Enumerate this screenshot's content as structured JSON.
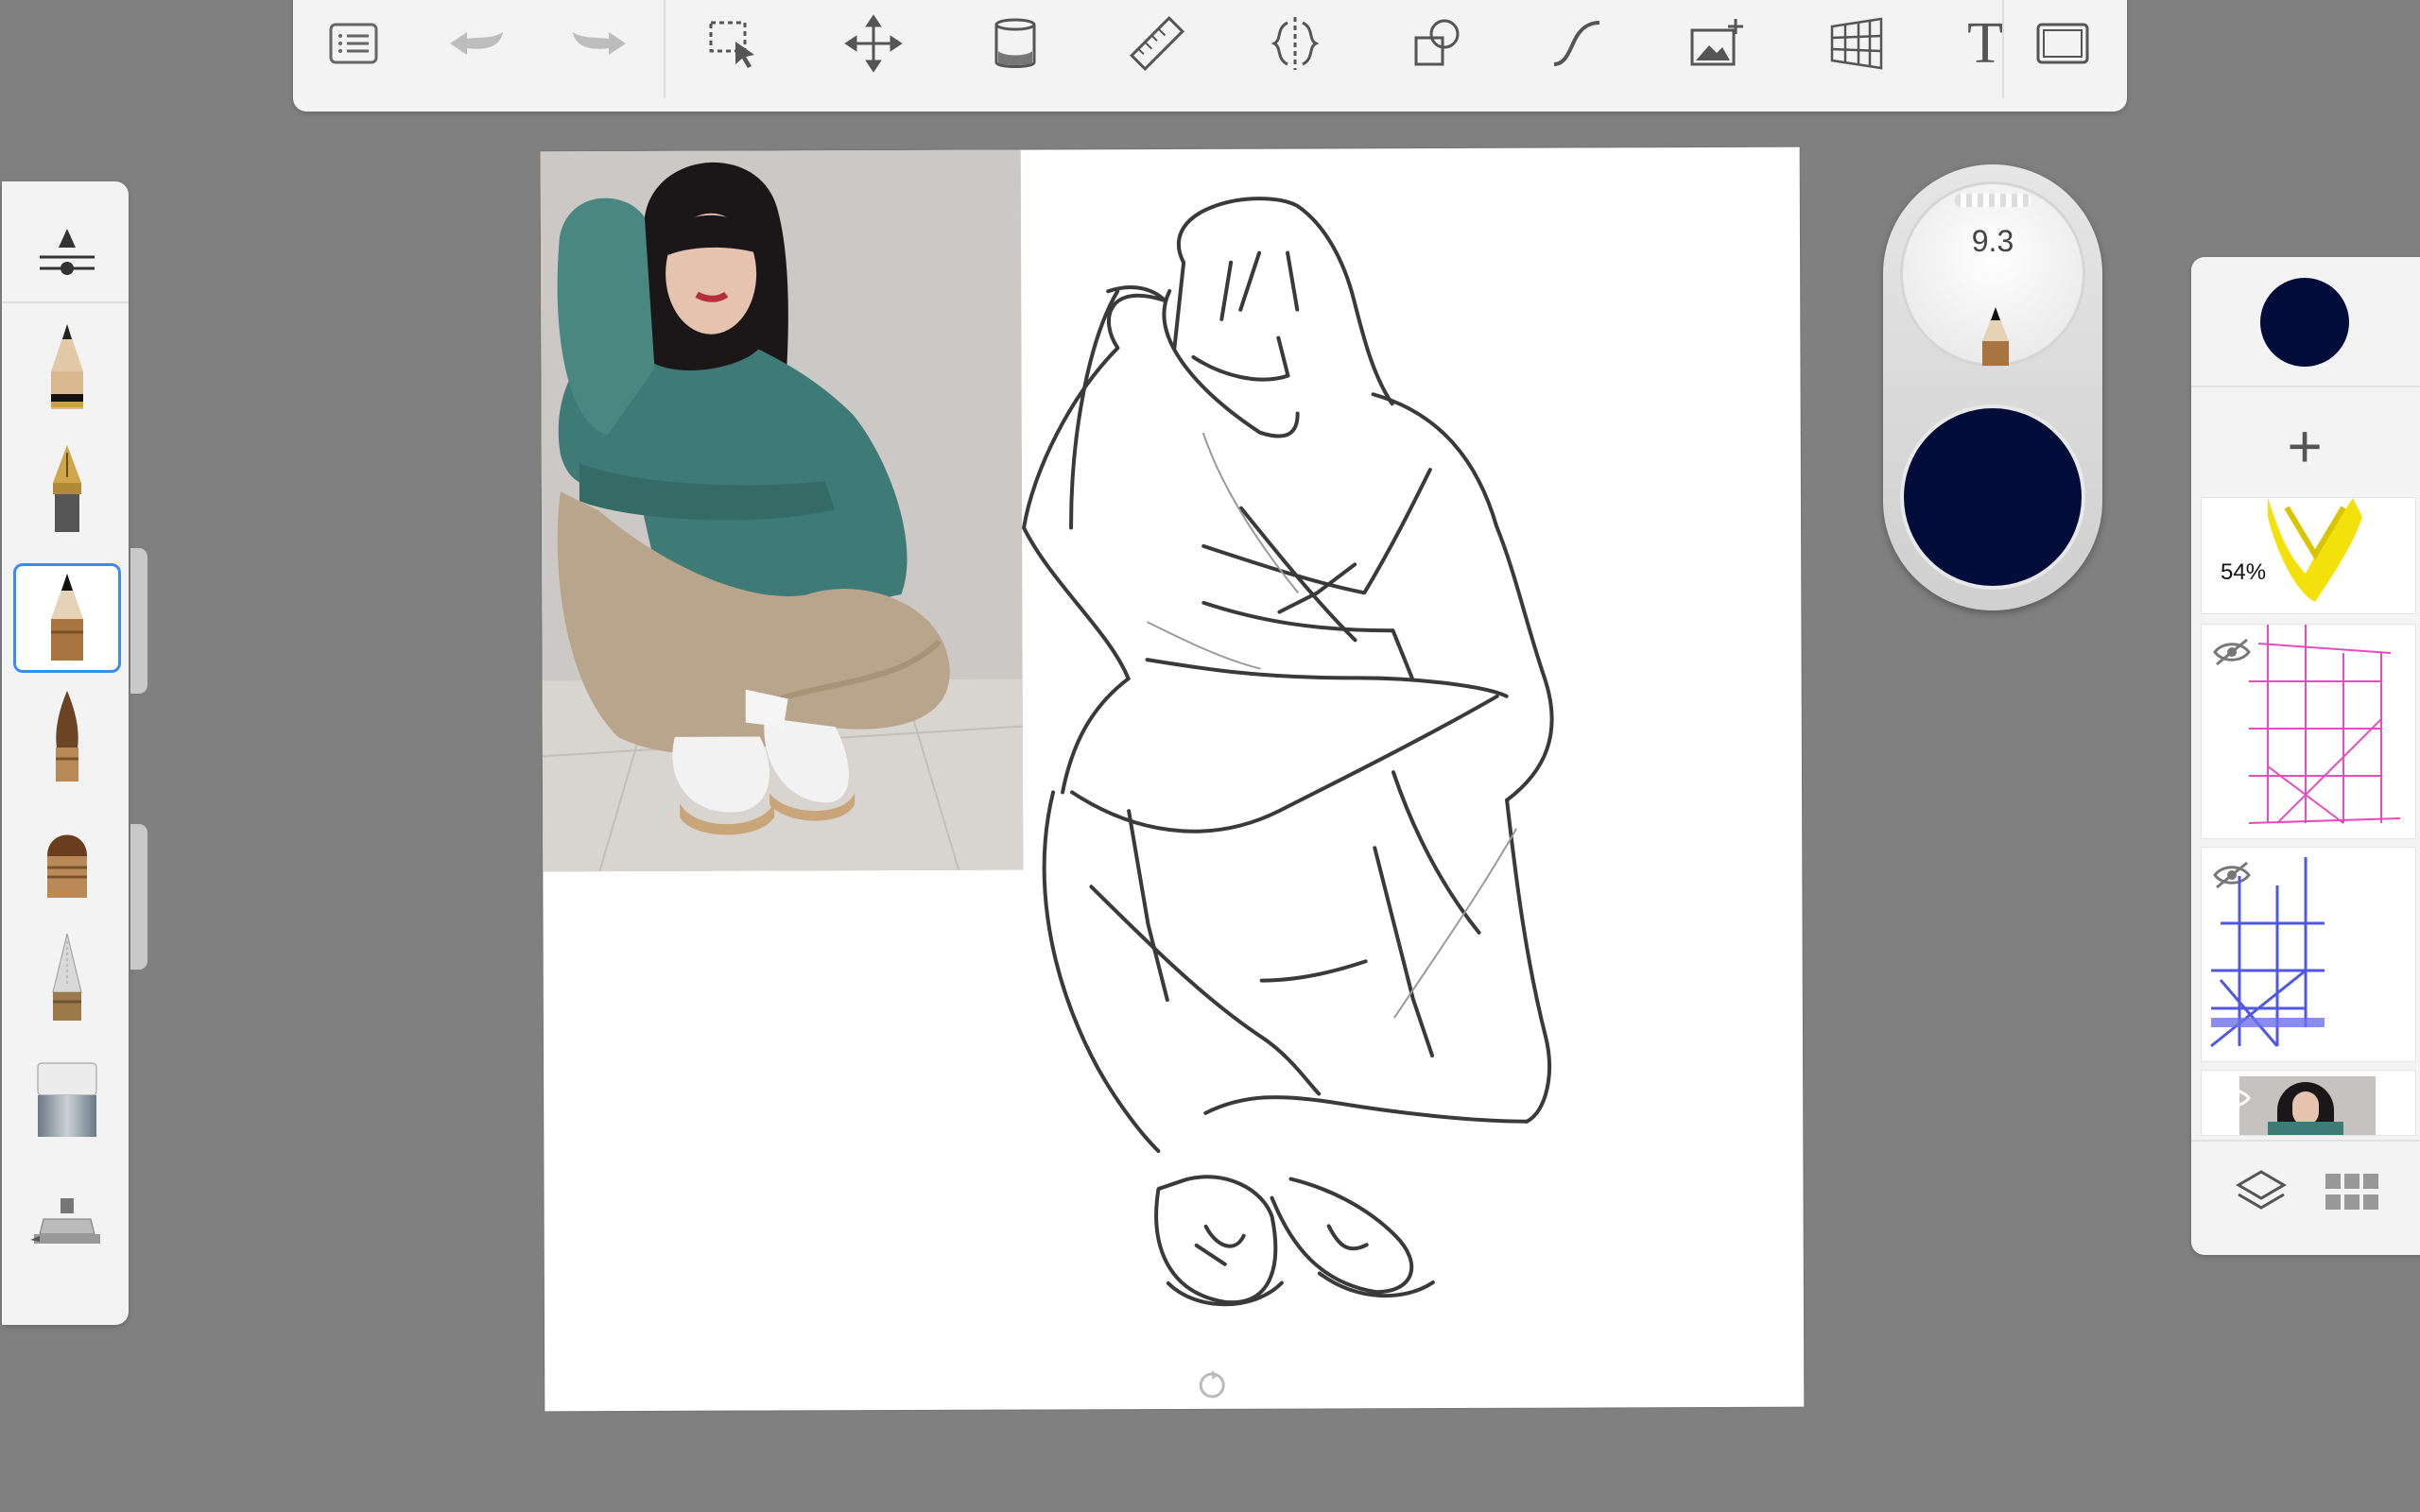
{
  "toolbar": {
    "items": [
      {
        "name": "menu-list",
        "icon": "list-icon"
      },
      {
        "name": "undo",
        "icon": "undo-icon"
      },
      {
        "name": "redo",
        "icon": "redo-icon"
      },
      {
        "name": "selection",
        "icon": "selection-icon"
      },
      {
        "name": "transform",
        "icon": "move-icon"
      },
      {
        "name": "fill",
        "icon": "paint-bucket-icon"
      },
      {
        "name": "ruler",
        "icon": "ruler-icon"
      },
      {
        "name": "symmetry",
        "icon": "symmetry-icon"
      },
      {
        "name": "shapes",
        "icon": "shapes-icon"
      },
      {
        "name": "stroke",
        "icon": "curve-icon"
      },
      {
        "name": "add-image",
        "icon": "add-image-icon"
      },
      {
        "name": "perspective",
        "icon": "perspective-grid-icon"
      },
      {
        "name": "text",
        "icon": "text-icon",
        "label": "T"
      },
      {
        "name": "fullscreen",
        "icon": "fullscreen-icon"
      }
    ]
  },
  "brush_palette": {
    "items": [
      {
        "name": "brush-properties",
        "icon": "brush-settings-icon"
      },
      {
        "name": "pencil",
        "icon": "pencil-icon"
      },
      {
        "name": "ink-pen",
        "icon": "fountain-pen-icon"
      },
      {
        "name": "hard-pencil",
        "icon": "pencil-icon",
        "selected": true
      },
      {
        "name": "paint-brush",
        "icon": "paintbrush-icon"
      },
      {
        "name": "flat-brush",
        "icon": "flat-brush-icon"
      },
      {
        "name": "airbrush",
        "icon": "airbrush-icon"
      },
      {
        "name": "eraser",
        "icon": "eraser-icon"
      },
      {
        "name": "smudge",
        "icon": "smudge-icon"
      }
    ]
  },
  "puck": {
    "brush_size": "9.3",
    "brush_icon": "pencil-icon",
    "color": "#020d3a"
  },
  "layers": {
    "current_color": "#020d3a",
    "add_label": "+",
    "items": [
      {
        "name": "layer-yellow",
        "opacity": "54%",
        "visible": true,
        "color": "#f4e10c"
      },
      {
        "name": "layer-pink-grid",
        "visible": false,
        "color": "#e64cbf"
      },
      {
        "name": "layer-blue-grid",
        "visible": false,
        "color": "#5057e0"
      },
      {
        "name": "layer-reference-photo",
        "visible": true
      }
    ],
    "footer": [
      {
        "name": "layers-toggle",
        "icon": "layers-icon"
      },
      {
        "name": "layer-grid-view",
        "icon": "grid-icon"
      }
    ]
  },
  "colors": {
    "background": "#808080",
    "panel": "#f3f3f3",
    "selection_accent": "#3b8cf2",
    "active_color": "#020d3a"
  }
}
